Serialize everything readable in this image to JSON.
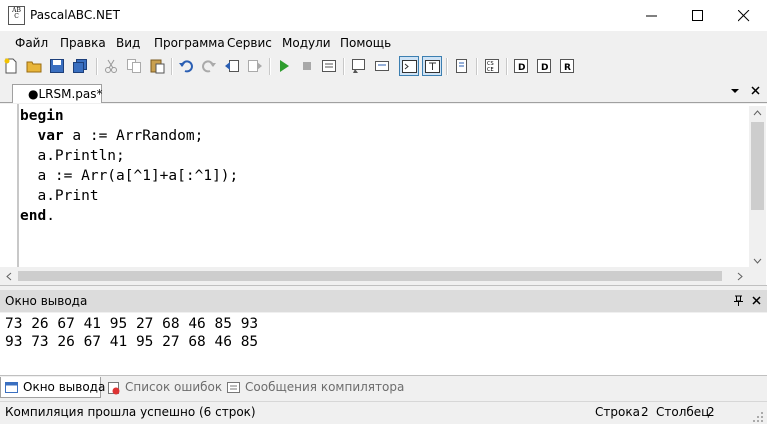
{
  "window": {
    "title": "PascalABC.NET",
    "icon_text": "AB  \nC"
  },
  "menu": [
    {
      "label": "Файл"
    },
    {
      "label": "Правка"
    },
    {
      "label": "Вид"
    },
    {
      "label": "Программа"
    },
    {
      "label": "Сервис"
    },
    {
      "label": "Модули"
    },
    {
      "label": "Помощь"
    }
  ],
  "toolbar": {
    "buttons": [
      "new-file-icon",
      "open-folder-icon",
      "save-icon",
      "save-all-icon",
      "cut-icon",
      "copy-icon",
      "paste-icon",
      "undo-icon",
      "redo-icon",
      "navigate-back-icon",
      "navigate-forward-icon",
      "run-icon",
      "stop-icon",
      "compile-icon",
      "output-window-icon",
      "output-window-2-icon",
      "console-toggle-icon",
      "text-mode-icon",
      "format-code-icon",
      "code-template-icon",
      "debug-step-into-icon",
      "debug-step-over-icon",
      "debug-run-to-icon"
    ]
  },
  "tabs": {
    "active_tab": "●LRSM.pas*"
  },
  "editor": {
    "lines": [
      {
        "kw": "begin",
        "rest": ""
      },
      {
        "indent": "  ",
        "kw": "var",
        "rest": " a := ArrRandom;"
      },
      {
        "indent": "  ",
        "kw": "",
        "rest": "a.Println;"
      },
      {
        "indent": "  ",
        "kw": "",
        "rest": "a := Arr(a[^1]+a[:^1]);"
      },
      {
        "indent": "  ",
        "kw": "",
        "rest": "a.Print"
      },
      {
        "kw": "end",
        "rest": "."
      }
    ]
  },
  "output": {
    "title": "Окно вывода",
    "lines": [
      "73 26 67 41 95 27 68 46 85 93",
      "93 73 26 67 41 95 27 68 46 85"
    ]
  },
  "bottom_tabs": [
    {
      "label": "Окно вывода",
      "active": true
    },
    {
      "label": "Список ошибок",
      "active": false
    },
    {
      "label": "Сообщения компилятора",
      "active": false
    }
  ],
  "status": {
    "message": "Компиляция прошла успешно (6 строк)",
    "row_label": "Строка",
    "row_value": "2",
    "col_label": "Столбец",
    "col_value": "2"
  },
  "colors": {
    "accent": "#3c7fb1",
    "run_green": "#2e9d2e"
  }
}
